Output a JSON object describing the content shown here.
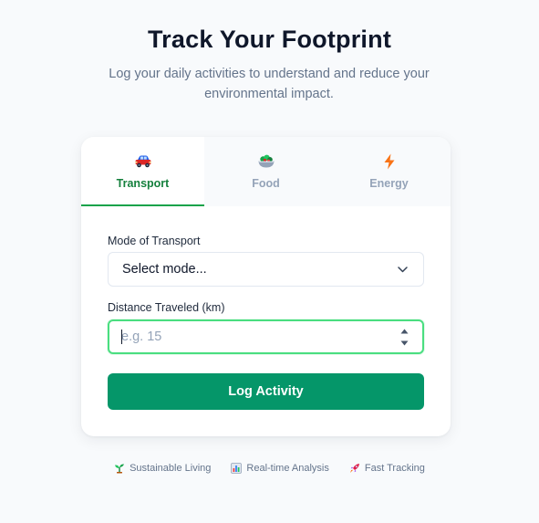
{
  "header": {
    "title": "Track Your Footprint",
    "subtitle": "Log your daily activities to understand and reduce your environmental impact."
  },
  "tabs": [
    {
      "label": "Transport",
      "icon": "car-icon",
      "active": true
    },
    {
      "label": "Food",
      "icon": "salad-bowl-icon",
      "active": false
    },
    {
      "label": "Energy",
      "icon": "lightning-icon",
      "active": false
    }
  ],
  "form": {
    "mode_label": "Mode of Transport",
    "mode_value": "Select mode...",
    "distance_label": "Distance Traveled (km)",
    "distance_placeholder": "e.g. 15",
    "distance_value": "",
    "submit_label": "Log Activity"
  },
  "features": [
    {
      "label": "Sustainable Living",
      "icon": "seedling-icon"
    },
    {
      "label": "Real-time Analysis",
      "icon": "bar-chart-icon"
    },
    {
      "label": "Fast Tracking",
      "icon": "rocket-icon"
    }
  ],
  "colors": {
    "accent": "#059669",
    "active_tab_text": "#15803d",
    "focus_ring": "#4ade80",
    "muted_text": "#64748b",
    "page_background": "#f8fafc"
  }
}
